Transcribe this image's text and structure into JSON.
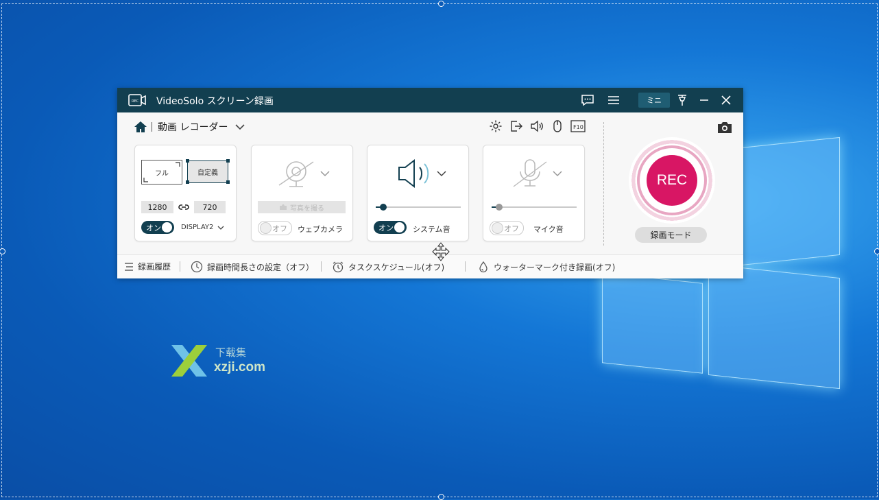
{
  "window": {
    "title": "VideoSolo スクリーン録画",
    "mini_label": "ミニ"
  },
  "subbar": {
    "mode_label": "動画 レコーダー"
  },
  "cards": {
    "screen": {
      "full_label": "フル",
      "custom_label": "自定義",
      "width": "1280",
      "height": "720",
      "toggle_label": "オン",
      "display_label": "DISPLAY2"
    },
    "webcam": {
      "photo_label": "写真を撮る",
      "toggle_label": "オフ",
      "label": "ウェブカメラ"
    },
    "system_audio": {
      "toggle_label": "オン",
      "label": "システム音",
      "level": 0.09
    },
    "mic": {
      "toggle_label": "オフ",
      "label": "マイク音",
      "level": 0.09
    }
  },
  "rec": {
    "label": "REC",
    "mode_label": "録画モード"
  },
  "bottombar": {
    "history": "録画履歴",
    "duration": "録画時間長さの設定（オフ）",
    "schedule": "タスクスケジュール(オフ)",
    "watermark": "ウォーターマーク付き録画(オフ)"
  },
  "desktop_watermark": {
    "text": "xzji.com",
    "cn_text": "下载集"
  },
  "colors": {
    "titlebar": "#123f50",
    "accent_rec": "#d81664",
    "desktop": "#1477d6"
  }
}
